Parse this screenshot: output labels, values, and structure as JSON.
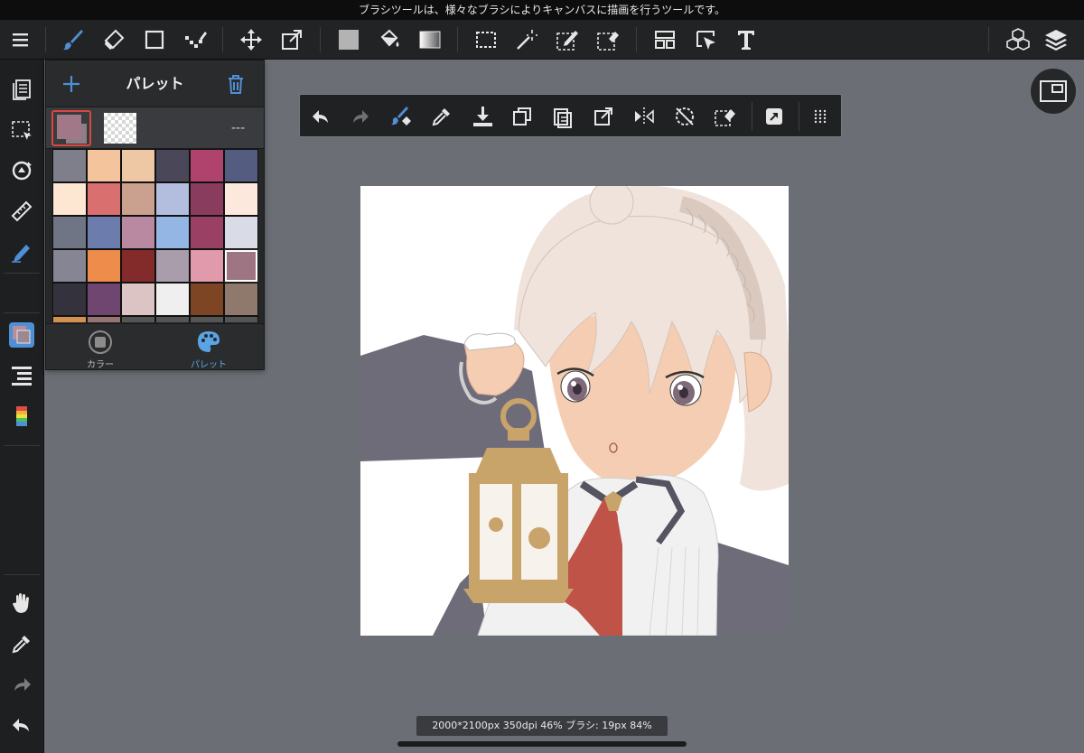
{
  "status_message": "ブラシツールは、様々なブラシによりキャンバスに描画を行うツールです。",
  "palette": {
    "title": "パレット",
    "current_fg": "#a07888",
    "current_bg": "#8f7d88",
    "dash_text": "---",
    "tabs": [
      {
        "label": "カラー",
        "active": false
      },
      {
        "label": "パレット",
        "active": true
      }
    ],
    "colors": [
      [
        "#7f7f8c",
        "#f4c49c",
        "#eec8a4",
        "#4a4858",
        "#b0436e",
        "#545c80"
      ],
      [
        "#fde6d2",
        "#da6f70",
        "#c9a18e",
        "#b3bedf",
        "#8a3c5e",
        "#fde8dd"
      ],
      [
        "#707585",
        "#6c7cad",
        "#b889a0",
        "#94b6e4",
        "#9b4065",
        "#d9dbe6"
      ],
      [
        "#868593",
        "#ee8c4c",
        "#832a2a",
        "#a99cab",
        "#e09aab",
        "#9e7583"
      ],
      [
        "#34333d",
        "#6e4670",
        "#ddc4c4",
        "#efefef",
        "#7e4524",
        "#8f796c"
      ],
      [
        "#d2914f",
        "#977472",
        "#555555",
        "#555555",
        "#555555",
        "#555555"
      ]
    ],
    "selected": [
      3,
      5
    ]
  },
  "info_bar": {
    "text": "2000*2100px 350dpi 46% ブラシ: 19px 84%"
  },
  "colors": {
    "accent": "#4f8fd6",
    "workspace": "#6b6f75",
    "toolbar": "#222325"
  }
}
